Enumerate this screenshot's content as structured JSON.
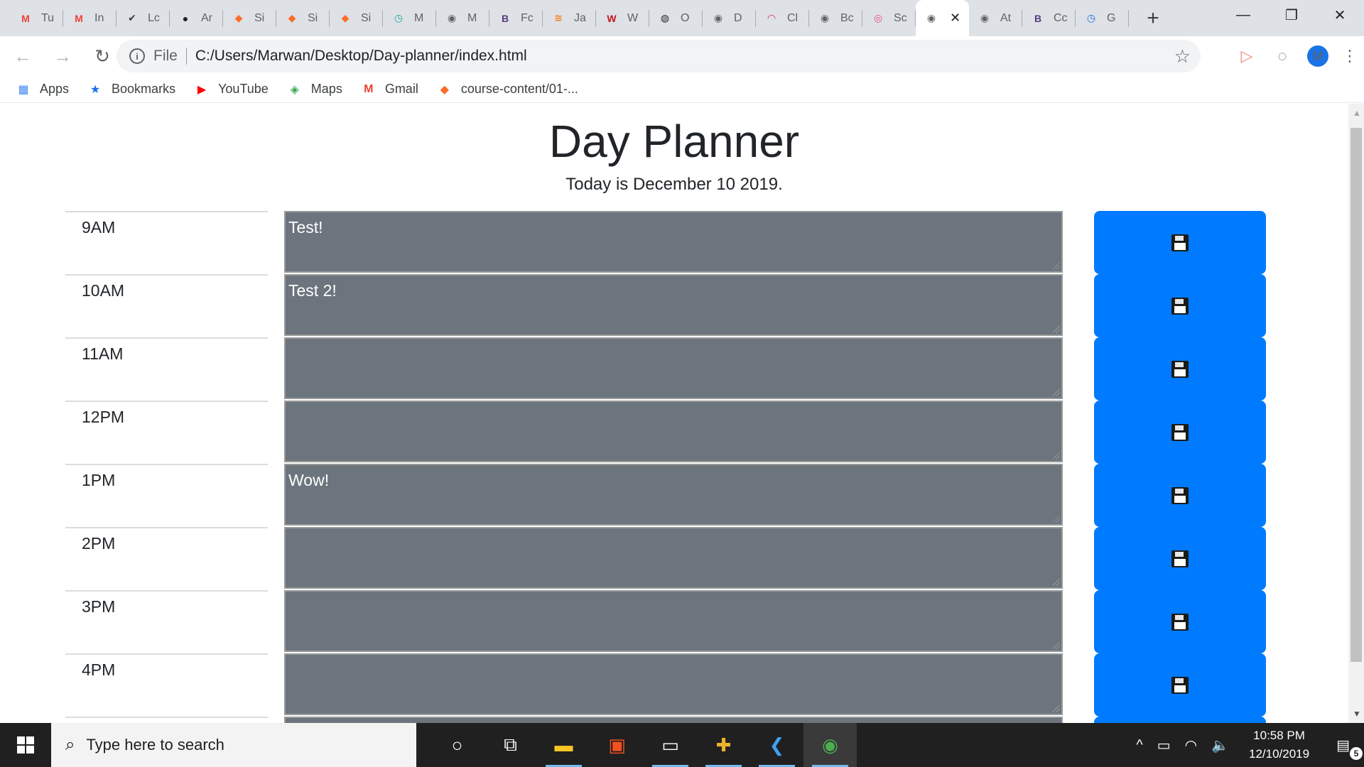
{
  "browser": {
    "tabs": [
      {
        "label": "Tu",
        "icon": "M",
        "icon_color": "#ea4335",
        "icon_name": "gmail-icon"
      },
      {
        "label": "In",
        "icon": "M",
        "icon_color": "#ea4335",
        "icon_name": "gmail-icon"
      },
      {
        "label": "Lc",
        "icon": "✔",
        "icon_color": "#3c4043",
        "icon_name": "shield-check-icon"
      },
      {
        "label": "Ar",
        "icon": "●",
        "icon_color": "#202124",
        "icon_name": "github-icon"
      },
      {
        "label": "Si",
        "icon": "◆",
        "icon_color": "#fc6d26",
        "icon_name": "gitlab-icon"
      },
      {
        "label": "Si",
        "icon": "◆",
        "icon_color": "#fc6d26",
        "icon_name": "gitlab-icon"
      },
      {
        "label": "Si",
        "icon": "◆",
        "icon_color": "#fc6d26",
        "icon_name": "gitlab-icon"
      },
      {
        "label": "M",
        "icon": "◷",
        "icon_color": "#26a69a",
        "icon_name": "clock-icon"
      },
      {
        "label": "M",
        "icon": "◉",
        "icon_color": "#5f6368",
        "icon_name": "globe-icon"
      },
      {
        "label": "Fc",
        "icon": "B",
        "icon_color": "#563d7c",
        "icon_name": "bootstrap-icon"
      },
      {
        "label": "Ja",
        "icon": "≋",
        "icon_color": "#f48024",
        "icon_name": "stackoverflow-icon"
      },
      {
        "label": "W",
        "icon": "W",
        "icon_color": "#c4161c",
        "icon_name": "w3schools-icon"
      },
      {
        "label": "O",
        "icon": "◍",
        "icon_color": "#24292e",
        "icon_name": "octocat-icon"
      },
      {
        "label": "D",
        "icon": "◉",
        "icon_color": "#5f6368",
        "icon_name": "globe-icon"
      },
      {
        "label": "Cl",
        "icon": "◠",
        "icon_color": "#e91e63",
        "icon_name": "rainbow-icon"
      },
      {
        "label": "Bc",
        "icon": "◉",
        "icon_color": "#5f6368",
        "icon_name": "globe-icon"
      },
      {
        "label": "Sc",
        "icon": "◎",
        "icon_color": "#e94b7b",
        "icon_name": "swirl-icon"
      },
      {
        "label": "",
        "icon": "◉",
        "icon_color": "#5f6368",
        "icon_name": "globe-icon",
        "active": true
      },
      {
        "label": "At",
        "icon": "◉",
        "icon_color": "#5f6368",
        "icon_name": "globe-icon"
      },
      {
        "label": "Cc",
        "icon": "B",
        "icon_color": "#563d7c",
        "icon_name": "bootstrap-icon"
      },
      {
        "label": "G",
        "icon": "◷",
        "icon_color": "#1a73e8",
        "icon_name": "clock-icon"
      }
    ],
    "close_glyph": "✕",
    "new_tab_glyph": "+",
    "window_controls": {
      "minimize": "—",
      "restore": "❐",
      "close": "✕"
    },
    "nav": {
      "back": "←",
      "forward": "→",
      "reload": "↻"
    },
    "address": {
      "info_glyph": "i",
      "scheme_label": "File",
      "url": "C:/Users/Marwan/Desktop/Day-planner/index.html",
      "star_glyph": "☆"
    },
    "extensions": {
      "cast": "▷",
      "ext": "◌",
      "avatar": "M",
      "menu": "⋮"
    },
    "bookmarks": [
      {
        "label": "Apps",
        "icon": "▦",
        "icon_color": "#4285f4",
        "icon_name": "apps-grid-icon"
      },
      {
        "label": "Bookmarks",
        "icon": "★",
        "icon_color": "#1a73e8",
        "icon_name": "star-icon"
      },
      {
        "label": "YouTube",
        "icon": "▶",
        "icon_color": "#ff0000",
        "icon_name": "youtube-icon"
      },
      {
        "label": "Maps",
        "icon": "◈",
        "icon_color": "#34a853",
        "icon_name": "maps-icon"
      },
      {
        "label": "Gmail",
        "icon": "M",
        "icon_color": "#ea4335",
        "icon_name": "gmail-icon"
      },
      {
        "label": "course-content/01-...",
        "icon": "◆",
        "icon_color": "#fc6d26",
        "icon_name": "gitlab-icon"
      }
    ]
  },
  "page": {
    "title": "Day Planner",
    "date_text": "Today is December 10 2019.",
    "rows": [
      {
        "hour": "9AM",
        "text": "Test!"
      },
      {
        "hour": "10AM",
        "text": "Test 2!"
      },
      {
        "hour": "11AM",
        "text": ""
      },
      {
        "hour": "12PM",
        "text": ""
      },
      {
        "hour": "1PM",
        "text": "Wow!"
      },
      {
        "hour": "2PM",
        "text": ""
      },
      {
        "hour": "3PM",
        "text": ""
      },
      {
        "hour": "4PM",
        "text": ""
      },
      {
        "hour": "",
        "text": ""
      }
    ],
    "colors": {
      "event_bg": "#6c757d",
      "save_bg": "#007bff"
    }
  },
  "taskbar": {
    "search_placeholder": "Type here to search",
    "apps": [
      {
        "name": "cortana-icon",
        "glyph": "○"
      },
      {
        "name": "task-view-icon",
        "glyph": "⧉"
      },
      {
        "name": "file-explorer-icon",
        "glyph": "▬",
        "color": "#f9c623",
        "running": true
      },
      {
        "name": "store-icon",
        "glyph": "▣",
        "color": "#f25022"
      },
      {
        "name": "terminal-icon",
        "glyph": "▭",
        "running": true
      },
      {
        "name": "slack-icon",
        "glyph": "✚",
        "color": "#ecb22e",
        "running": true
      },
      {
        "name": "vscode-icon",
        "glyph": "❮",
        "color": "#3ea1f2",
        "running": true
      },
      {
        "name": "chrome-icon",
        "glyph": "◉",
        "color": "#4caf50",
        "running": true,
        "active": true
      }
    ],
    "tray": {
      "chevron": "^",
      "battery": "▭",
      "wifi": "◠",
      "volume": "🔈"
    },
    "time": "10:58 PM",
    "date": "12/10/2019",
    "notification_count": "5",
    "notification_glyph": "▤"
  }
}
